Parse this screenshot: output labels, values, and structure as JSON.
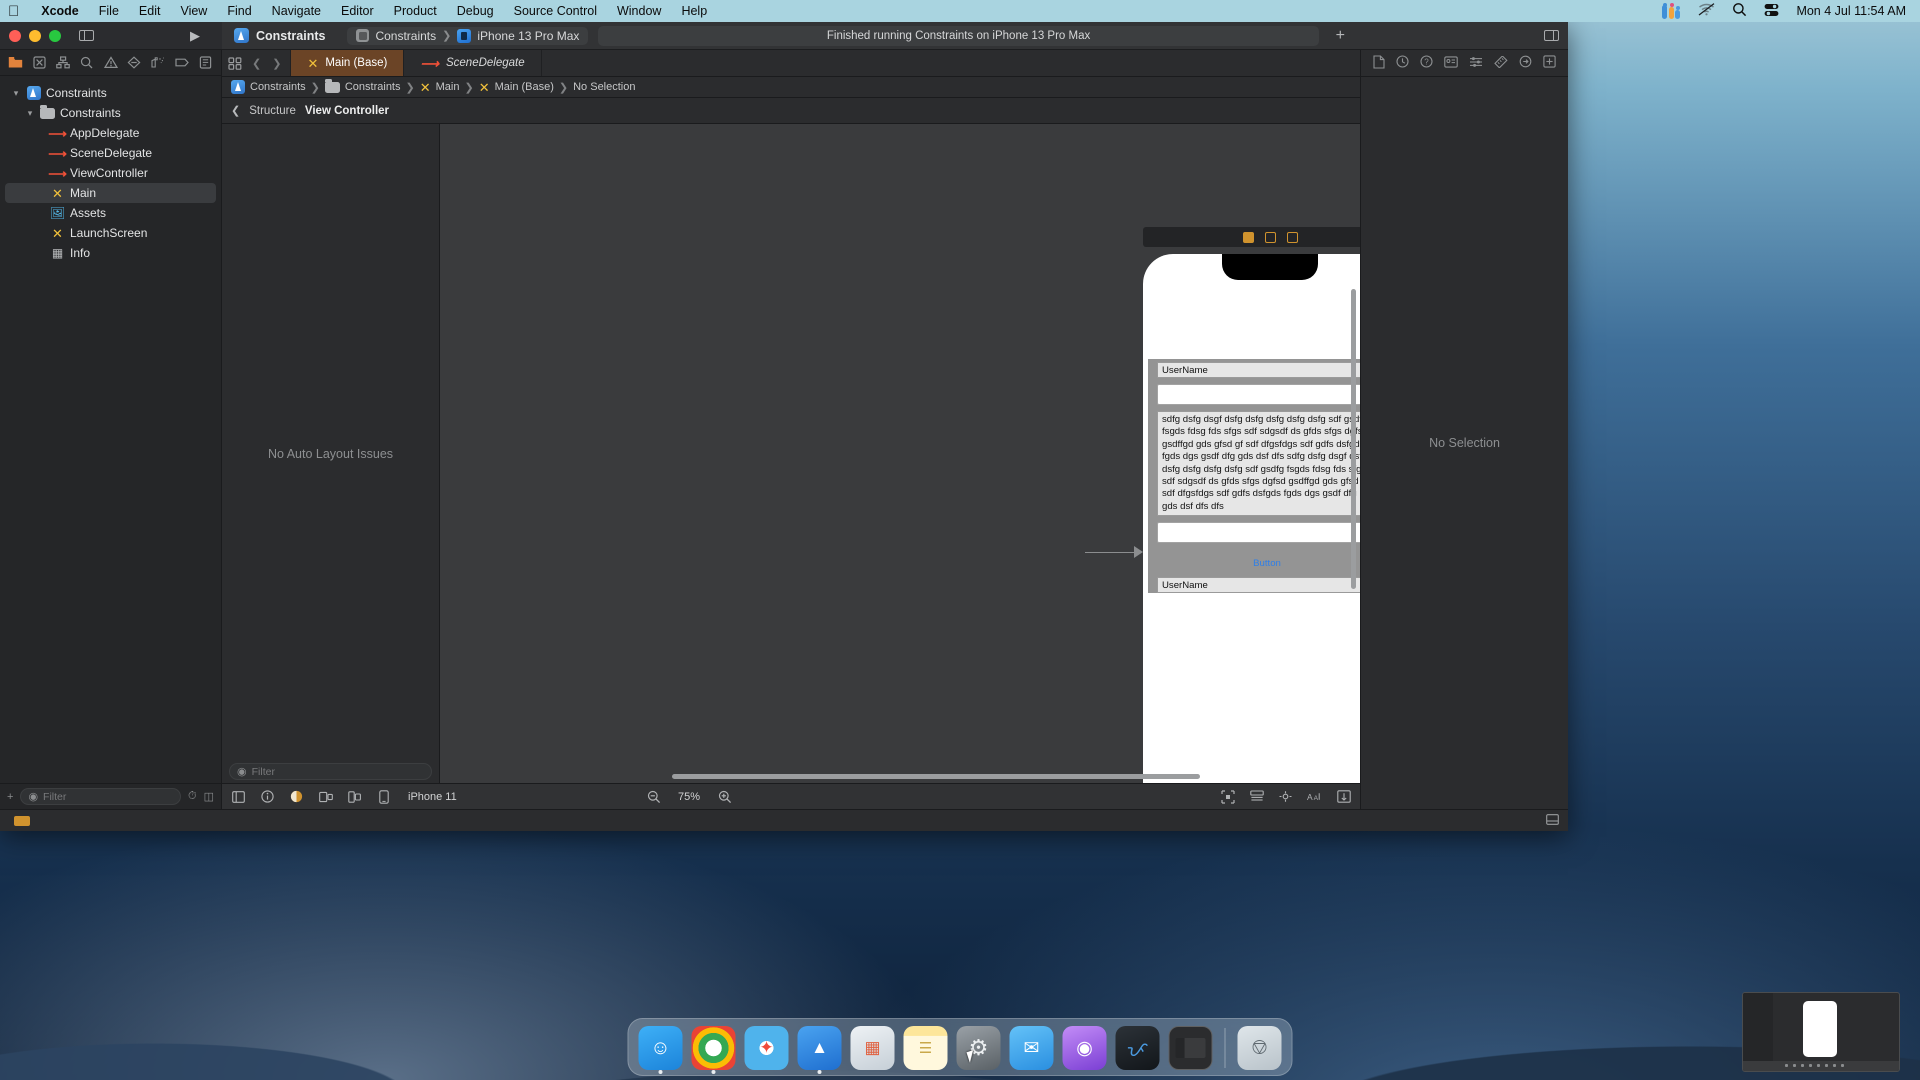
{
  "menubar": {
    "apple_icon": "apple-logo-icon",
    "items": [
      {
        "label": "Xcode",
        "bold": true
      },
      {
        "label": "File",
        "bold": false
      },
      {
        "label": "Edit",
        "bold": false
      },
      {
        "label": "View",
        "bold": false
      },
      {
        "label": "Find",
        "bold": false
      },
      {
        "label": "Navigate",
        "bold": false
      },
      {
        "label": "Editor",
        "bold": false
      },
      {
        "label": "Product",
        "bold": false
      },
      {
        "label": "Debug",
        "bold": false
      },
      {
        "label": "Source Control",
        "bold": false
      },
      {
        "label": "Window",
        "bold": false
      },
      {
        "label": "Help",
        "bold": false
      }
    ],
    "status_icons": [
      "microphone-levels-icon",
      "wifi-off-icon",
      "search-icon",
      "control-center-icon"
    ],
    "clock": "Mon 4 Jul  11:54 AM"
  },
  "toolbar": {
    "run_icon": "run-play-icon",
    "sidebar_toggle_icon": "toggle-navigator-icon",
    "app_icon": "xcode-project-icon",
    "app_name": "Constraints",
    "scheme": "Constraints",
    "scheme_chevron": "❯",
    "destination": "iPhone 13 Pro Max",
    "status_message": "Finished running Constraints on iPhone 13 Pro Max",
    "add_label": "+",
    "inspector_toggle_icon": "toggle-inspector-icon"
  },
  "navigator": {
    "tabs": [
      {
        "name": "project-navigator-tab",
        "icon": "folder-icon",
        "active": true
      },
      {
        "name": "source-control-navigator-tab",
        "icon": "boxed-x-icon",
        "active": false
      },
      {
        "name": "symbol-navigator-tab",
        "icon": "hierarchy-icon",
        "active": false
      },
      {
        "name": "find-navigator-tab",
        "icon": "search-icon",
        "active": false
      },
      {
        "name": "issue-navigator-tab",
        "icon": "warning-triangle-icon",
        "active": false
      },
      {
        "name": "test-navigator-tab",
        "icon": "diamond-icon",
        "active": false
      },
      {
        "name": "debug-navigator-tab",
        "icon": "spray-icon",
        "active": false
      },
      {
        "name": "breakpoint-navigator-tab",
        "icon": "breakpoint-icon",
        "active": false
      },
      {
        "name": "report-navigator-tab",
        "icon": "report-icon",
        "active": false
      }
    ],
    "tree": [
      {
        "label": "Constraints",
        "icon": "xcode-project-icon",
        "indent": 0,
        "disclosure": "open",
        "selected": false
      },
      {
        "label": "Constraints",
        "icon": "folder-icon",
        "indent": 1,
        "disclosure": "open",
        "selected": false
      },
      {
        "label": "AppDelegate",
        "icon": "swift-file-icon",
        "indent": 2,
        "disclosure": "",
        "selected": false
      },
      {
        "label": "SceneDelegate",
        "icon": "swift-file-icon",
        "indent": 2,
        "disclosure": "",
        "selected": false
      },
      {
        "label": "ViewController",
        "icon": "swift-file-icon",
        "indent": 2,
        "disclosure": "",
        "selected": false
      },
      {
        "label": "Main",
        "icon": "storyboard-icon",
        "indent": 2,
        "disclosure": "",
        "selected": true
      },
      {
        "label": "Assets",
        "icon": "assets-catalog-icon",
        "indent": 2,
        "disclosure": "",
        "selected": false
      },
      {
        "label": "LaunchScreen",
        "icon": "storyboard-icon",
        "indent": 2,
        "disclosure": "",
        "selected": false
      },
      {
        "label": "Info",
        "icon": "plist-icon",
        "indent": 2,
        "disclosure": "",
        "selected": false
      }
    ],
    "filter_placeholder": "Filter",
    "add_label": "+",
    "filter_icons": [
      "clock-icon",
      "split-icon"
    ]
  },
  "editor": {
    "jump_bar_icon": "related-items-icon",
    "back_arrow": "❮",
    "forward_arrow": "❯",
    "tabs": [
      {
        "label": "Main (Base)",
        "icon": "storyboard-icon",
        "active": true,
        "italic": false
      },
      {
        "label": "SceneDelegate",
        "icon": "swift-file-icon",
        "active": false,
        "italic": true
      }
    ],
    "breadcrumb": [
      {
        "label": "Constraints",
        "icon": "xcode-project-icon"
      },
      {
        "label": "Constraints",
        "icon": "folder-icon"
      },
      {
        "label": "Main",
        "icon": "storyboard-icon"
      },
      {
        "label": "Main (Base)",
        "icon": "storyboard-icon"
      },
      {
        "label": "No Selection",
        "icon": ""
      }
    ],
    "breadcrumb_separator": "❯",
    "outline_back": "❮",
    "outline_back_label": "Structure",
    "outline_current": "View Controller",
    "outline_message": "No Auto Layout Issues",
    "outline_filter_placeholder": "Filter"
  },
  "canvas": {
    "device_toolbar_icons": [
      "pause-icon",
      "cube-icon",
      "layers-icon"
    ],
    "scene": {
      "username_label_top": "UserName",
      "paragraph": "sdfg dsfg dsgf dsfg dsfg dsfg dsfg dsfg sdf gsdfg fsgds fdsg fds sfgs sdf sdgsdf ds gfds sfgs dgfsd gsdffgd gds  gfsd gf sdf dfgsfdgs sdf gdfs dsfgds fgds dgs gsdf dfg gds  dsf dfs sdfg dsfg dsgf dsfg dsfg dsfg dsfg dsfg sdf gsdfg fsgds fdsg fds sfgs sdf sdgsdf ds gfds sfgs dgfsd gsdffgd gds  gfsd gf sdf dfgsfdgs sdf gdfs dsfgds fgds dgs gsdf dfg gds  dsf dfs dfs",
      "button_label": "Button",
      "username_label_bottom": "UserName"
    }
  },
  "canvas_bar": {
    "left_icons": [
      "view-as-icon",
      "info-icon",
      "appearance-icon",
      "variants-icon",
      "device-orientation-icon",
      "device-icon"
    ],
    "device_label": "iPhone 11",
    "zoom_out_icon": "zoom-out-icon",
    "zoom_value": "75%",
    "zoom_in_icon": "zoom-in-icon",
    "right_icons": [
      "align-icon",
      "embed-icon",
      "resolve-issues-icon",
      "update-frames-icon",
      "add-constraints-icon"
    ]
  },
  "inspector": {
    "tabs": [
      {
        "name": "file-inspector-tab",
        "icon": "document-icon",
        "active": false
      },
      {
        "name": "history-inspector-tab",
        "icon": "clock-icon",
        "active": false
      },
      {
        "name": "quick-help-inspector-tab",
        "icon": "question-icon",
        "active": false
      },
      {
        "name": "identity-inspector-tab",
        "icon": "id-card-icon",
        "active": false
      },
      {
        "name": "attributes-inspector-tab",
        "icon": "sliders-icon",
        "active": false
      },
      {
        "name": "size-inspector-tab",
        "icon": "ruler-icon",
        "active": false
      },
      {
        "name": "connections-inspector-tab",
        "icon": "arrow-circle-icon",
        "active": false
      },
      {
        "name": "library-inspector-tab",
        "icon": "plus-square-icon",
        "active": false
      }
    ],
    "message": "No Selection"
  },
  "bottom_bar": {
    "warning_badge": "build-warning-badge",
    "right_icon": "console-toggle-icon"
  },
  "dock": {
    "items": [
      {
        "name": "finder",
        "label": "Finder",
        "color1": "#3eb0f7",
        "color2": "#1c84da",
        "glyph": "☺",
        "running": true
      },
      {
        "name": "chrome",
        "label": "Google Chrome",
        "color1": "#f5f5f5",
        "color2": "#e2e2e2",
        "glyph": "◉",
        "running": true
      },
      {
        "name": "safari",
        "label": "Safari",
        "color1": "#e9f4fb",
        "color2": "#bcd9ee",
        "glyph": "◎",
        "running": false
      },
      {
        "name": "xcode",
        "label": "Xcode",
        "color1": "#4aa3f0",
        "color2": "#1f6fd0",
        "glyph": "▲",
        "running": true
      },
      {
        "name": "launchpad",
        "label": "Launchpad",
        "color1": "#d7dde3",
        "color2": "#b8c2cb",
        "glyph": "▦",
        "running": false
      },
      {
        "name": "notes",
        "label": "Notes",
        "color1": "#fde69a",
        "color2": "#f7cf5e",
        "glyph": "▤",
        "running": false
      },
      {
        "name": "settings",
        "label": "System Settings",
        "color1": "#8e9499",
        "color2": "#5f666b",
        "glyph": "⚙",
        "running": false
      },
      {
        "name": "mail",
        "label": "Mail",
        "color1": "#64c2f8",
        "color2": "#2a8fe0",
        "glyph": "✉",
        "running": false
      },
      {
        "name": "podcasts",
        "label": "Podcasts",
        "color1": "#a76bf0",
        "color2": "#7b3fd4",
        "glyph": "◉",
        "running": false
      },
      {
        "name": "keynote",
        "label": "Keynote",
        "color1": "#2c3238",
        "color2": "#1a1f24",
        "glyph": "ᛉ",
        "running": false
      }
    ],
    "trash_label": "Trash",
    "trash_glyph": "🗑"
  }
}
